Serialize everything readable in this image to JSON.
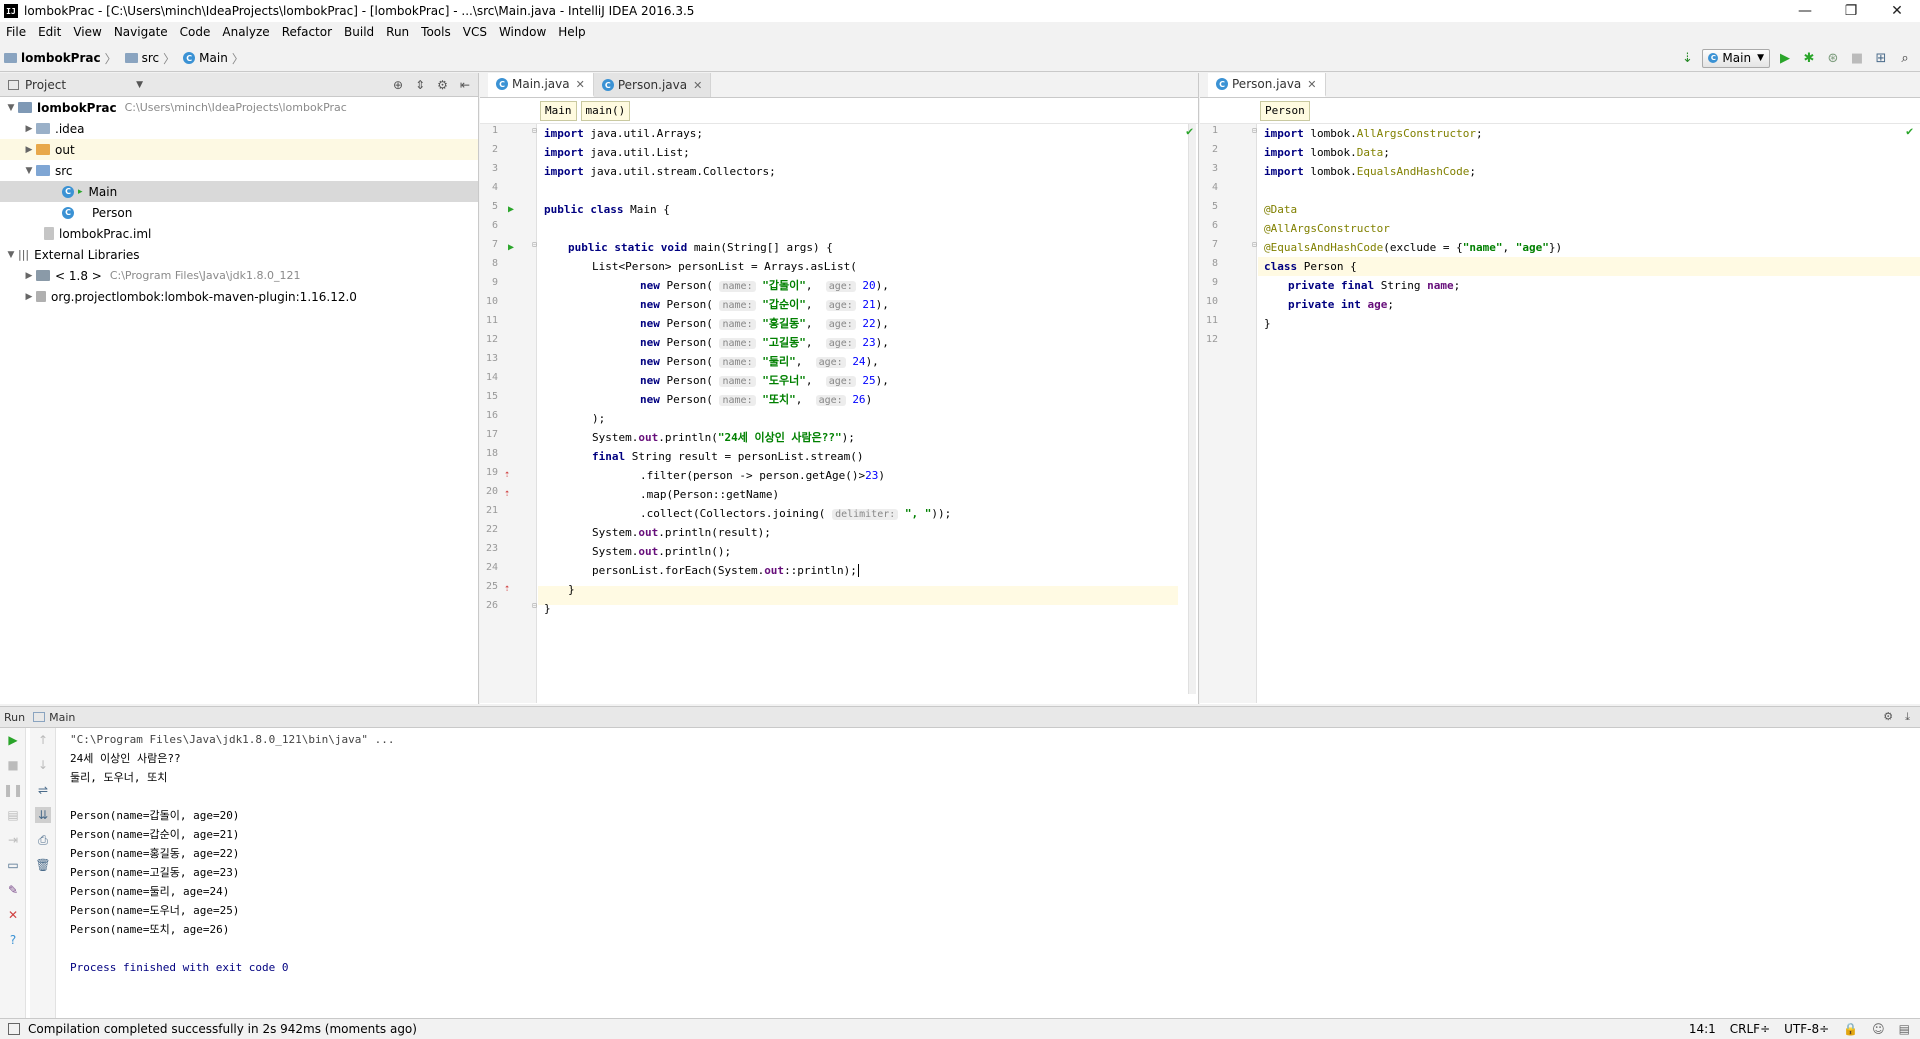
{
  "window": {
    "title": "lombokPrac - [C:\\Users\\minch\\IdeaProjects\\lombokPrac] - [lombokPrac] - ...\\src\\Main.java - IntelliJ IDEA 2016.3.5",
    "icon_label": "IJ",
    "minimize": "—",
    "maximize": "❐",
    "close": "✕"
  },
  "menu": [
    "File",
    "Edit",
    "View",
    "Navigate",
    "Code",
    "Analyze",
    "Refactor",
    "Build",
    "Run",
    "Tools",
    "VCS",
    "Window",
    "Help"
  ],
  "nav": {
    "crumbs": [
      "lombokPrac",
      "src",
      "Main"
    ],
    "run_config": "Main"
  },
  "project_panel": {
    "title": "Project",
    "tree": [
      {
        "label": "lombokPrac",
        "path": "C:\\Users\\minch\\IdeaProjects\\lombokPrac"
      },
      {
        "label": ".idea"
      },
      {
        "label": "out"
      },
      {
        "label": "src"
      },
      {
        "label": "Main"
      },
      {
        "label": "Person"
      },
      {
        "label": "lombokPrac.iml"
      },
      {
        "label": "External Libraries"
      },
      {
        "label": "< 1.8 >",
        "path": "C:\\Program Files\\Java\\jdk1.8.0_121"
      },
      {
        "label": "org.projectlombok:lombok-maven-plugin:1.16.12.0"
      }
    ]
  },
  "editor_left": {
    "tabs": [
      "Main.java",
      "Person.java"
    ],
    "breadcrumbs": [
      "Main",
      "main()"
    ],
    "line_numbers": [
      "1",
      "2",
      "3",
      "4",
      "5",
      "6",
      "7",
      "8",
      "9",
      "10",
      "11",
      "12",
      "13",
      "14",
      "15",
      "16",
      "17",
      "18",
      "19",
      "20",
      "21",
      "22",
      "23",
      "24",
      "25",
      "26"
    ],
    "code": {
      "l1a": "import",
      "l1b": " java.util.Arrays;",
      "l2a": "import",
      "l2b": " java.util.List;",
      "l3a": "import",
      "l3b": " java.util.stream.Collectors;",
      "l5a": "public class",
      "l5b": " Main {",
      "l7a": "public static void",
      "l7b": " main(String[] args) {",
      "l8": "List<Person> personList = Arrays.asList(",
      "new_kw": "new",
      "person_open": " Person( ",
      "hint_name": "name:",
      "hint_age": "age:",
      "persons": [
        {
          "name": "\"갑돌이\"",
          "age": "20",
          "end": "),"
        },
        {
          "name": "\"갑순이\"",
          "age": "21",
          "end": "),"
        },
        {
          "name": "\"홍길동\"",
          "age": "22",
          "end": "),"
        },
        {
          "name": "\"고길동\"",
          "age": "23",
          "end": "),"
        },
        {
          "name": "\"둘리\"",
          "age": "24",
          "end": "),"
        },
        {
          "name": "\"도우너\"",
          "age": "25",
          "end": "),"
        },
        {
          "name": "\"또치\"",
          "age": "26",
          "end": ")"
        }
      ],
      "l16": ");",
      "sys_out": "System.",
      "out_fld": "out",
      "l17b": ".println(",
      "l17str": "\"24세 이상인 사람은??\"",
      "l17c": ");",
      "l18a": "final",
      "l18b": " String result = personList.stream()",
      "l19a": ".filter(person -> person.getAge()>",
      "l19num": "23",
      "l19b": ")",
      "l20": ".map(Person::getName)",
      "l21a": ".collect(Collectors.joining( ",
      "l21hint": "delimiter:",
      "l21str": " \", \"",
      "l21b": "));",
      "l22b": ".println(result);",
      "l23b": ".println();",
      "l24a": "personList.forEach(System.",
      "l24b": "::println);",
      "l25": "}",
      "l26": "}"
    }
  },
  "editor_right": {
    "tabs": [
      "Person.java"
    ],
    "breadcrumbs": [
      "Person"
    ],
    "line_numbers": [
      "1",
      "2",
      "3",
      "4",
      "5",
      "6",
      "7",
      "8",
      "9",
      "10",
      "11",
      "12"
    ],
    "code": {
      "import_kw": "import",
      "l1pkg": " lombok.",
      "l1cls": "AllArgsConstructor",
      "l2cls": "Data",
      "l3cls": "EqualsAndHashCode",
      "semi": ";",
      "l5": "@Data",
      "l6": "@AllArgsConstructor",
      "l7a": "@EqualsAndHashCode",
      "l7b": "(exclude = {",
      "l7s1": "\"name\"",
      "l7c": ", ",
      "l7s2": "\"age\"",
      "l7d": "})",
      "l8a": "class",
      "l8b": " Person {",
      "l9a": "private final",
      "l9b": " String ",
      "l9f": "name",
      "l10a": "private int",
      "l10b": " ",
      "l10f": "age",
      "l11": "}"
    }
  },
  "run_panel": {
    "label": "Run",
    "config": "Main",
    "lines": [
      "\"C:\\Program Files\\Java\\jdk1.8.0_121\\bin\\java\" ...",
      "24세 이상인 사람은??",
      "둘리, 도우너, 또치",
      "",
      "Person(name=갑돌이, age=20)",
      "Person(name=갑순이, age=21)",
      "Person(name=홍길동, age=22)",
      "Person(name=고길동, age=23)",
      "Person(name=둘리, age=24)",
      "Person(name=도우너, age=25)",
      "Person(name=또치, age=26)",
      "",
      "Process finished with exit code 0"
    ]
  },
  "status": {
    "message": "Compilation completed successfully in 2s 942ms (moments ago)",
    "position": "14:1",
    "line_sep": "CRLF÷",
    "encoding": "UTF-8÷"
  },
  "colors": {
    "accent_blue": "#3b92d4",
    "run_green": "#2aa52a",
    "selection": "#d9d9d9",
    "current_line": "#fffae3"
  }
}
